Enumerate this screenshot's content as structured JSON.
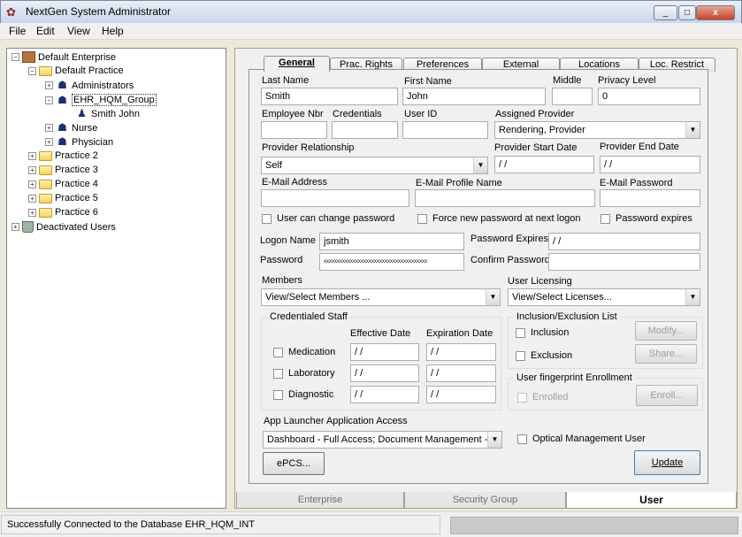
{
  "window": {
    "title": "NextGen System Administrator",
    "close_glyph": "x",
    "min_glyph": "_",
    "max_glyph": "□"
  },
  "menu": [
    "File",
    "Edit",
    "View",
    "Help"
  ],
  "tree": {
    "enterprise": "Default Enterprise",
    "practice": "Default Practice",
    "administrators": "Administrators",
    "ehr_group": "EHR_HQM_Group",
    "member": "Smith John",
    "nurse": "Nurse",
    "physician": "Physician",
    "practice2": "Practice 2",
    "practice3": "Practice 3",
    "practice4": "Practice 4",
    "practice5": "Practice 5",
    "practice6": "Practice 6",
    "deactivated": "Deactivated Users",
    "expand_glyph": "+",
    "collapse_glyph": "−"
  },
  "tabs": [
    "General",
    "Prac. Rights",
    "Preferences",
    "External",
    "Locations",
    "Loc. Restrict"
  ],
  "form": {
    "last_name_label": "Last Name",
    "last_name": "Smith",
    "first_name_label": "First Name",
    "first_name": "John",
    "middle_label": "Middle",
    "middle": "",
    "privacy_label": "Privacy Level",
    "privacy": "0",
    "emp_label": "Employee Nbr",
    "emp": "",
    "cred_label": "Credentials",
    "cred": "",
    "userid_label": "User ID",
    "userid": "",
    "assigned_label": "Assigned Provider",
    "assigned": "Rendering, Provider",
    "relationship_label": "Provider Relationship",
    "relationship": "Self",
    "start_label": "Provider Start Date",
    "start": " / /",
    "end_label": "Provider End Date",
    "end": " / /",
    "email_label": "E-Mail Address",
    "email": "",
    "email_profile_label": "E-Mail Profile Name",
    "email_profile": "",
    "email_pw_label": "E-Mail Password",
    "email_pw": "",
    "chk_change": "User can change password",
    "chk_force": "Force new password at next logon",
    "chk_expires": "Password expires",
    "logon_label": "Logon Name",
    "logon": "jsmith",
    "pw_expires_label": "Password Expires",
    "pw_expires": " / /",
    "password_label": "Password",
    "password": "xxxxxxxxxxxxxxxxxxxxxxxxxxxxxxxxxxxxxxx",
    "confirm_label": "Confirm Password",
    "confirm": "",
    "members_label": "Members",
    "members": "View/Select Members ...",
    "licensing_label": "User Licensing",
    "licensing": "View/Select Licenses...",
    "cred_staff": {
      "title": "Credentialed Staff",
      "eff": "Effective Date",
      "exp": "Expiration Date",
      "rows": [
        {
          "label": "Medication",
          "eff": " / /",
          "exp": " / /"
        },
        {
          "label": "Laboratory",
          "eff": " / /",
          "exp": " / /"
        },
        {
          "label": "Diagnostic",
          "eff": " / /",
          "exp": " / /"
        }
      ]
    },
    "incl": {
      "title": "Inclusion/Exclusion List",
      "inclusion": "Inclusion",
      "exclusion": "Exclusion",
      "modify": "Modify...",
      "share": "Share..."
    },
    "fp": {
      "title": "User fingerprint Enrollment",
      "enrolled": "Enrolled",
      "enroll": "Enroll..."
    },
    "app_label": "App Launcher Application Access",
    "app": "Dashboard - Full Access; Document Management - F",
    "optical": "Optical Management User",
    "epcs": "ePCS...",
    "update": "Update",
    "dropdown_glyph": "▼"
  },
  "bottom_tabs": [
    "Enterprise",
    "Security Group",
    "User"
  ],
  "status": "Successfully Connected to the Database EHR_HQM_INT"
}
